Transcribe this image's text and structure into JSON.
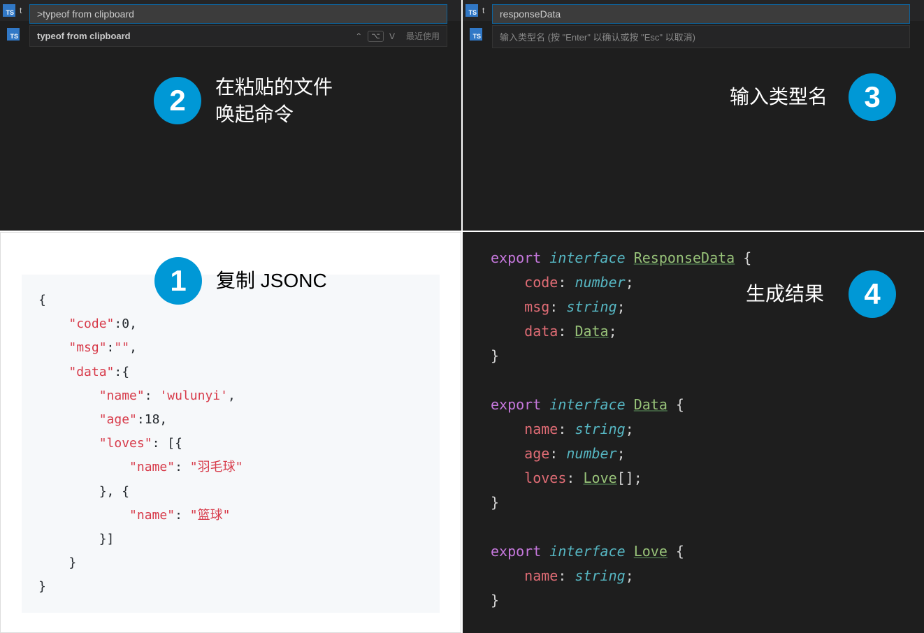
{
  "panel2": {
    "tab_prefix": "t",
    "palette_input": ">typeof from clipboard",
    "suggestion": "typeof from clipboard",
    "recent_label": "最近使用",
    "step_num": "2",
    "step_text_line1": "在粘贴的文件",
    "step_text_line2": "唤起命令"
  },
  "panel3": {
    "tab_prefix": "t",
    "palette_input": "responseData",
    "hint": "输入类型名 (按 \"Enter\" 以确认或按 \"Esc\" 以取消)",
    "step_num": "3",
    "step_text": "输入类型名"
  },
  "panel1": {
    "step_num": "1",
    "step_text": "复制 JSONC",
    "json_lines": [
      {
        "indent": 0,
        "parts": [
          {
            "t": "p",
            "v": "{"
          }
        ]
      },
      {
        "indent": 1,
        "parts": [
          {
            "t": "k",
            "v": "\"code\""
          },
          {
            "t": "p",
            "v": ":0,"
          }
        ]
      },
      {
        "indent": 1,
        "parts": [
          {
            "t": "k",
            "v": "\"msg\""
          },
          {
            "t": "p",
            "v": ":"
          },
          {
            "t": "s",
            "v": "\"\""
          },
          {
            "t": "p",
            "v": ","
          }
        ]
      },
      {
        "indent": 1,
        "parts": [
          {
            "t": "k",
            "v": "\"data\""
          },
          {
            "t": "p",
            "v": ":{"
          }
        ]
      },
      {
        "indent": 2,
        "parts": [
          {
            "t": "k",
            "v": "\"name\""
          },
          {
            "t": "p",
            "v": ": "
          },
          {
            "t": "s",
            "v": "'wulunyi'"
          },
          {
            "t": "p",
            "v": ","
          }
        ]
      },
      {
        "indent": 2,
        "parts": [
          {
            "t": "k",
            "v": "\"age\""
          },
          {
            "t": "p",
            "v": ":18,"
          }
        ]
      },
      {
        "indent": 2,
        "parts": [
          {
            "t": "k",
            "v": "\"loves\""
          },
          {
            "t": "p",
            "v": ": [{"
          }
        ]
      },
      {
        "indent": 3,
        "parts": [
          {
            "t": "k",
            "v": "\"name\""
          },
          {
            "t": "p",
            "v": ": "
          },
          {
            "t": "s",
            "v": "\"羽毛球\""
          }
        ]
      },
      {
        "indent": 2,
        "parts": [
          {
            "t": "p",
            "v": "}, {"
          }
        ]
      },
      {
        "indent": 3,
        "parts": [
          {
            "t": "k",
            "v": "\"name\""
          },
          {
            "t": "p",
            "v": ": "
          },
          {
            "t": "s",
            "v": "\"篮球\""
          }
        ]
      },
      {
        "indent": 2,
        "parts": [
          {
            "t": "p",
            "v": "}]"
          }
        ]
      },
      {
        "indent": 1,
        "parts": [
          {
            "t": "p",
            "v": "}"
          }
        ]
      },
      {
        "indent": 0,
        "parts": [
          {
            "t": "p",
            "v": "}"
          }
        ]
      }
    ]
  },
  "panel4": {
    "step_num": "4",
    "step_text": "生成结果",
    "ts_lines": [
      [
        {
          "c": "tk-export",
          "v": "export"
        },
        {
          "c": "tk-punc",
          "v": " "
        },
        {
          "c": "tk-keyword",
          "v": "interface"
        },
        {
          "c": "tk-punc",
          "v": " "
        },
        {
          "c": "tk-type",
          "v": "ResponseData"
        },
        {
          "c": "tk-punc",
          "v": " {"
        }
      ],
      [
        {
          "c": "tk-punc",
          "v": "    "
        },
        {
          "c": "tk-ident",
          "v": "code"
        },
        {
          "c": "tk-punc",
          "v": ": "
        },
        {
          "c": "tk-prim",
          "v": "number"
        },
        {
          "c": "tk-punc",
          "v": ";"
        }
      ],
      [
        {
          "c": "tk-punc",
          "v": "    "
        },
        {
          "c": "tk-ident",
          "v": "msg"
        },
        {
          "c": "tk-punc",
          "v": ": "
        },
        {
          "c": "tk-prim",
          "v": "string"
        },
        {
          "c": "tk-punc",
          "v": ";"
        }
      ],
      [
        {
          "c": "tk-punc",
          "v": "    "
        },
        {
          "c": "tk-ident",
          "v": "data"
        },
        {
          "c": "tk-punc",
          "v": ": "
        },
        {
          "c": "tk-type",
          "v": "Data"
        },
        {
          "c": "tk-punc",
          "v": ";"
        }
      ],
      [
        {
          "c": "tk-punc",
          "v": "}"
        }
      ],
      [
        {
          "c": "tk-punc",
          "v": ""
        }
      ],
      [
        {
          "c": "tk-export",
          "v": "export"
        },
        {
          "c": "tk-punc",
          "v": " "
        },
        {
          "c": "tk-keyword",
          "v": "interface"
        },
        {
          "c": "tk-punc",
          "v": " "
        },
        {
          "c": "tk-type",
          "v": "Data"
        },
        {
          "c": "tk-punc",
          "v": " {"
        }
      ],
      [
        {
          "c": "tk-punc",
          "v": "    "
        },
        {
          "c": "tk-ident",
          "v": "name"
        },
        {
          "c": "tk-punc",
          "v": ": "
        },
        {
          "c": "tk-prim",
          "v": "string"
        },
        {
          "c": "tk-punc",
          "v": ";"
        }
      ],
      [
        {
          "c": "tk-punc",
          "v": "    "
        },
        {
          "c": "tk-ident",
          "v": "age"
        },
        {
          "c": "tk-punc",
          "v": ": "
        },
        {
          "c": "tk-prim",
          "v": "number"
        },
        {
          "c": "tk-punc",
          "v": ";"
        }
      ],
      [
        {
          "c": "tk-punc",
          "v": "    "
        },
        {
          "c": "tk-ident",
          "v": "loves"
        },
        {
          "c": "tk-punc",
          "v": ": "
        },
        {
          "c": "tk-type",
          "v": "Love"
        },
        {
          "c": "tk-punc",
          "v": "[];"
        }
      ],
      [
        {
          "c": "tk-punc",
          "v": "}"
        }
      ],
      [
        {
          "c": "tk-punc",
          "v": ""
        }
      ],
      [
        {
          "c": "tk-export",
          "v": "export"
        },
        {
          "c": "tk-punc",
          "v": " "
        },
        {
          "c": "tk-keyword",
          "v": "interface"
        },
        {
          "c": "tk-punc",
          "v": " "
        },
        {
          "c": "tk-type",
          "v": "Love"
        },
        {
          "c": "tk-punc",
          "v": " {"
        }
      ],
      [
        {
          "c": "tk-punc",
          "v": "    "
        },
        {
          "c": "tk-ident",
          "v": "name"
        },
        {
          "c": "tk-punc",
          "v": ": "
        },
        {
          "c": "tk-prim",
          "v": "string"
        },
        {
          "c": "tk-punc",
          "v": ";"
        }
      ],
      [
        {
          "c": "tk-punc",
          "v": "}"
        }
      ]
    ]
  }
}
